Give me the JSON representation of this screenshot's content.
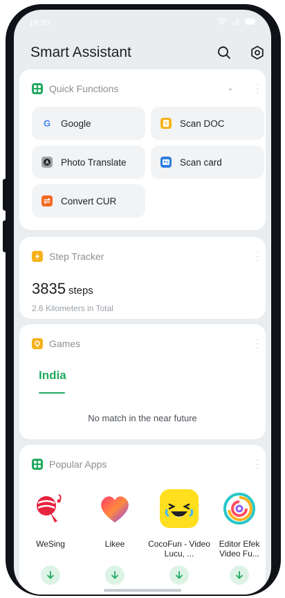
{
  "status_bar": {
    "time": "19:30"
  },
  "header": {
    "title": "Smart Assistant"
  },
  "quick_functions": {
    "title": "Quick Functions",
    "items": [
      {
        "label": "Google",
        "icon": "google-icon"
      },
      {
        "label": "Scan DOC",
        "icon": "scan-doc-icon"
      },
      {
        "label": "Photo Translate",
        "icon": "photo-translate-icon"
      },
      {
        "label": "Scan card",
        "icon": "scan-card-icon"
      },
      {
        "label": "Convert CUR",
        "icon": "convert-currency-icon"
      }
    ]
  },
  "step_tracker": {
    "title": "Step Tracker",
    "steps": "3835",
    "steps_unit": "steps",
    "distance": "2.6  Kilometers in Total"
  },
  "games": {
    "title": "Games",
    "tab": "India",
    "empty_text": "No match in the near future"
  },
  "popular_apps": {
    "title": "Popular Apps",
    "apps": [
      {
        "name": "WeSing",
        "icon": "wesing-icon"
      },
      {
        "name": "Likee",
        "icon": "likee-icon"
      },
      {
        "name": "CocoFun - Video Lucu, ...",
        "icon": "cocofun-icon"
      },
      {
        "name": "Editor Efek Video Fu...",
        "icon": "editor-swirl-icon"
      }
    ]
  },
  "colors": {
    "accent_green": "#21a960",
    "download_bg": "#ddf3e6",
    "card_bg": "#ffffff",
    "screen_bg": "#e9edf0"
  }
}
